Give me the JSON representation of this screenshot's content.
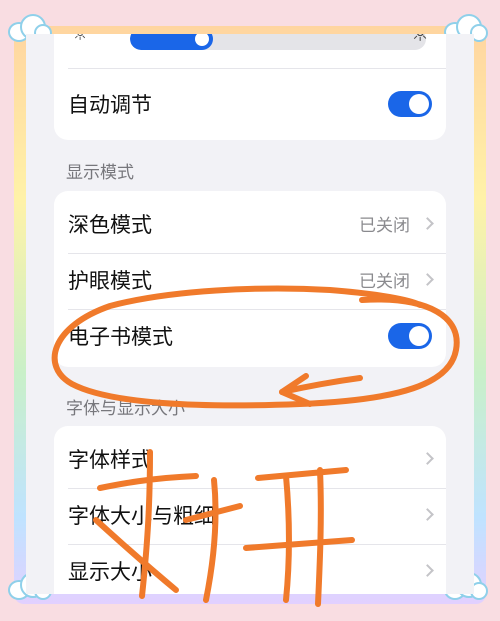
{
  "brightness": {
    "level_fraction": 0.28,
    "low_icon": "sun-small-icon",
    "high_icon": "sun-large-icon"
  },
  "auto_adjust": {
    "label": "自动调节",
    "enabled": true
  },
  "display_mode": {
    "section_title": "显示模式",
    "items": [
      {
        "label": "深色模式",
        "value": "已关闭"
      },
      {
        "label": "护眼模式",
        "value": "已关闭"
      },
      {
        "label": "电子书模式",
        "enabled": true
      }
    ]
  },
  "font_section": {
    "section_title": "字体与显示大小",
    "items": [
      {
        "label": "字体样式"
      },
      {
        "label": "字体大小与粗细"
      },
      {
        "label": "显示大小"
      }
    ]
  },
  "annotation": {
    "handwritten_text": "打开"
  },
  "colors": {
    "accent": "#1a66e8",
    "annotation": "#f07a2b",
    "background": "#f2f2f6"
  }
}
